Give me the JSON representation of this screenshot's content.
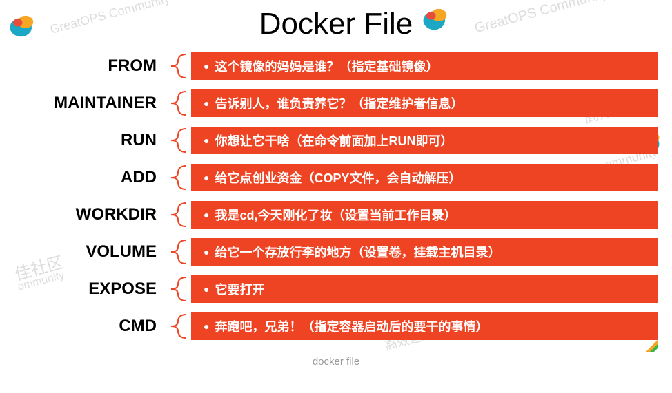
{
  "title": "Docker File",
  "caption": "docker file",
  "watermarks": {
    "wm1": "GreatOPS Community",
    "wm2": "GreatOPS Community",
    "wm3": "佳社区",
    "wm3b": "ommunity",
    "wm4": "高效运维社",
    "wm5": "高效运维社区",
    "wm6": "ommunity"
  },
  "rows": [
    {
      "label": "FROM",
      "desc": "这个镜像的妈妈是谁？（指定基础镜像）"
    },
    {
      "label": "MAINTAINER",
      "desc": "告诉别人，谁负责养它？（指定维护者信息）"
    },
    {
      "label": "RUN",
      "desc": "你想让它干啥（在命令前面加上RUN即可）"
    },
    {
      "label": "ADD",
      "desc": "给它点创业资金（COPY文件，会自动解压）"
    },
    {
      "label": "WORKDIR",
      "desc": "我是cd,今天刚化了妆（设置当前工作目录）"
    },
    {
      "label": "VOLUME",
      "desc": "给它一个存放行李的地方（设置卷，挂载主机目录）"
    },
    {
      "label": "EXPOSE",
      "desc": "它要打开"
    },
    {
      "label": "CMD",
      "desc": "奔跑吧，兄弟！（指定容器启动后的要干的事情）"
    }
  ]
}
